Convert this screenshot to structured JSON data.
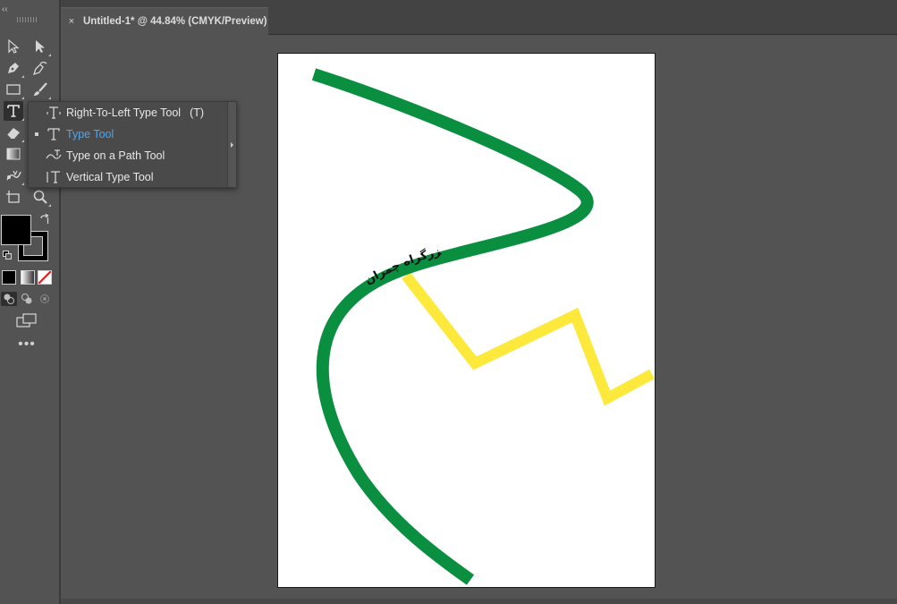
{
  "document_tab": {
    "close_label": "×",
    "title": "Untitled-1* @ 44.84% (CMYK/Preview)"
  },
  "toolbar": {
    "collapse_label": "‹‹",
    "more_label": "•••",
    "tools": [
      "selection-tool",
      "direct-selection-tool",
      "pen-tool",
      "curvature-tool",
      "rectangle-tool",
      "paintbrush-tool",
      "type-tool",
      "eraser-tool",
      "gradient-tool",
      "puppet-warp-tool",
      "artboard-tool",
      "zoom-tool"
    ]
  },
  "flyout": {
    "items": [
      {
        "label": "Right-To-Left Type Tool",
        "shortcut": "(T)",
        "icon": "right-to-left-type-icon",
        "selected": false
      },
      {
        "label": "Type Tool",
        "shortcut": "",
        "icon": "type-icon",
        "selected": true
      },
      {
        "label": "Type on a Path Tool",
        "shortcut": "",
        "icon": "type-on-path-icon",
        "selected": false
      },
      {
        "label": "Vertical Type Tool",
        "shortcut": "",
        "icon": "vertical-type-icon",
        "selected": false
      }
    ]
  },
  "artwork": {
    "path_text": "بزرگراه چمران",
    "colors": {
      "green_path": "#0a8f41",
      "yellow_path": "#fde93b",
      "artboard": "#ffffff",
      "selected_menu_text": "#4aa8f0"
    }
  }
}
